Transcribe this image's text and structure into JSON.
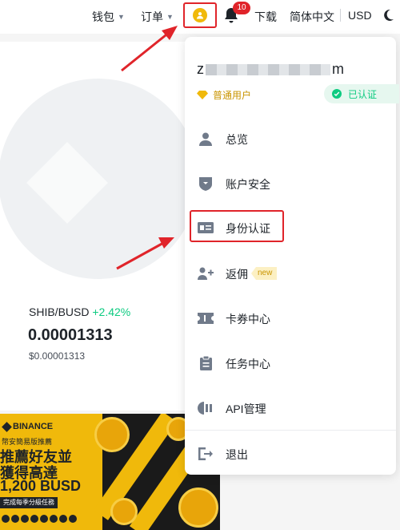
{
  "topbar": {
    "wallet_label": "钱包",
    "orders_label": "订单",
    "notification_count": "10",
    "download_label": "下载",
    "language_label": "简体中文",
    "currency_label": "USD"
  },
  "market": {
    "pair": "SHIB/BUSD",
    "change": "+2.42%",
    "price": "0.00001313",
    "usd_price": "$0.00001313"
  },
  "banner": {
    "brand": "BINANCE",
    "small_line": "幣安簡易版推薦",
    "line1": "推薦好友並",
    "line2": "獲得高達",
    "line3": "1,200 BUSD",
    "tag": "完成每季分級任務"
  },
  "dropdown": {
    "email_start": "z",
    "email_end": "m",
    "level_label": "普通用户",
    "verified_label": "已认证",
    "items": [
      {
        "label": "总览",
        "icon": "person-icon"
      },
      {
        "label": "账户安全",
        "icon": "shield-icon"
      },
      {
        "label": "身份认证",
        "icon": "id-card-icon"
      },
      {
        "label": "返佣",
        "icon": "add-user-icon",
        "badge": "new"
      },
      {
        "label": "卡券中心",
        "icon": "ticket-icon"
      },
      {
        "label": "任务中心",
        "icon": "clipboard-icon"
      },
      {
        "label": "API管理",
        "icon": "api-icon"
      },
      {
        "label": "退出",
        "icon": "logout-icon"
      }
    ]
  },
  "colors": {
    "accent_yellow": "#F0B90B",
    "positive_green": "#0ECB81",
    "annotation_red": "#E0242A"
  }
}
